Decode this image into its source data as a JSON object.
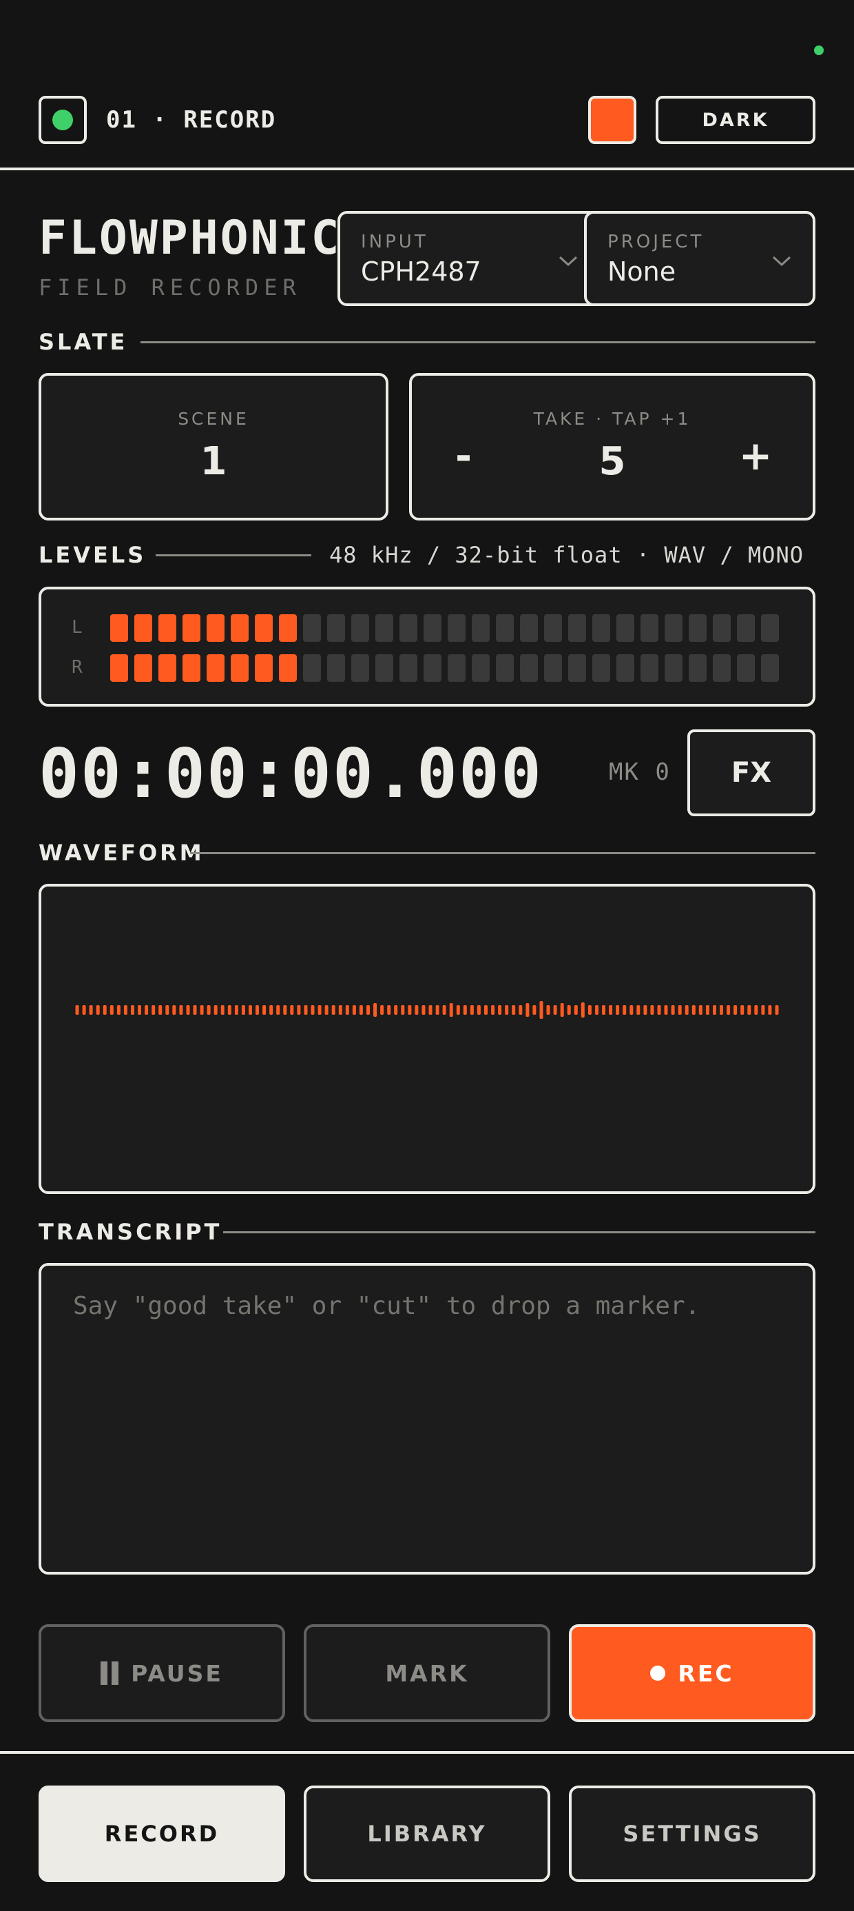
{
  "header": {
    "title": "01 · RECORD",
    "theme_label": "DARK",
    "accent_color": "#ff5a1f",
    "status_color": "#3fd06a"
  },
  "brand": {
    "name": "FLOWPHONIC",
    "subtitle": "FIELD RECORDER"
  },
  "input": {
    "label": "INPUT",
    "value": "CPH2487"
  },
  "project": {
    "label": "PROJECT",
    "value": "None"
  },
  "slate": {
    "section_title": "SLATE",
    "scene_label": "SCENE",
    "scene_value": "1",
    "take_label": "TAKE · TAP +1",
    "take_value": "5",
    "minus_label": "-",
    "plus_label": "+"
  },
  "levels": {
    "section_title": "LEVELS",
    "format": "48 kHz / 32-bit float · WAV / MONO",
    "left_label": "L",
    "right_label": "R",
    "total_segments": 28,
    "left_active": 8,
    "right_active": 8
  },
  "timecode": "00:00:00.000",
  "marker_count": "MK 0",
  "fx_label": "FX",
  "waveform": {
    "section_title": "WAVEFORM",
    "color": "#ff5a1f"
  },
  "transcript": {
    "section_title": "TRANSCRIPT",
    "placeholder": "Say \"good take\" or \"cut\" to drop a marker."
  },
  "transport": {
    "pause_label": "PAUSE",
    "mark_label": "MARK",
    "rec_label": "REC"
  },
  "nav": {
    "record": "RECORD",
    "library": "LIBRARY",
    "settings": "SETTINGS",
    "active": "record"
  }
}
